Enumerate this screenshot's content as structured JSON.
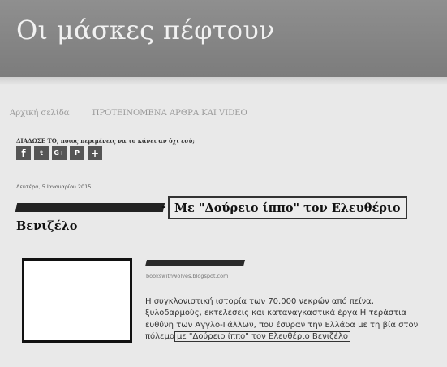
{
  "blog": {
    "title": "Οι μάσκες πέφτουν"
  },
  "nav": {
    "home": "Αρχική σελίδα",
    "featured": "ΠΡΟΤΕΙΝΟΜΕΝΑ ΑΡΘΡΑ ΚΑΙ VIDEO"
  },
  "share": {
    "label": "ΔΙΑΔΩΣΕ ΤΟ, ποιος περιμένεις να το κάνει αν όχι εσύ;",
    "buttons": [
      {
        "icon": "facebook-icon",
        "glyph": "f"
      },
      {
        "icon": "twitter-icon",
        "glyph": "t"
      },
      {
        "icon": "google-plus-icon",
        "glyph": "G+"
      },
      {
        "icon": "pinterest-icon",
        "glyph": "P"
      },
      {
        "icon": "add-icon",
        "glyph": "+"
      }
    ]
  },
  "post": {
    "date": "Δευτέρα, 5 Ιανουαρίου 2015",
    "title_dash": "-",
    "title_boxed": "Με \"Δούρειο ίππο\" τον Ελευθέριο",
    "title_line2": "Βενιζέλο",
    "source": "bookswithwolves.blogspot.com",
    "excerpt": {
      "line1": "Η συγκλονιστική ιστορία των 70.000 νεκρών από πείνα,",
      "line2": "ξυλοδαρμούς, εκτελέσεις και καταναγκαστικά έργα Η τεράστια",
      "line3": "ευθύνη των Αγγλο-Γάλλων, που έσυραν την Ελλάδα με τη βία στον",
      "line4_before": "πόλεμο",
      "line4_boxed": "με \"Δούρειο ίππο\" τον Ελευθέριο Βενιζέλο"
    }
  }
}
